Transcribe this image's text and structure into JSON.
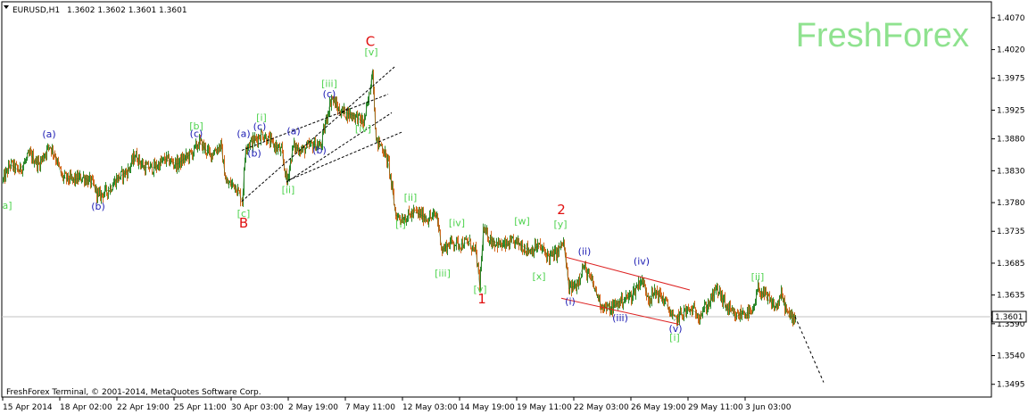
{
  "header": {
    "symbol_timeframe": "EURUSD,H1",
    "ohlc": "1.3602 1.3602 1.3601 1.3601"
  },
  "watermark": "FreshForex",
  "footer": "FreshForex Terminal, © 2001-2014, MetaQuotes Software Corp.",
  "colors": {
    "bull_candle": "#2e8b2e",
    "bear_candle": "#d2691e",
    "green_label": "#4fd34f",
    "blue_label": "#1e1eb4",
    "red_label": "#e01010",
    "watermark": "#8fe28f",
    "channel_red": "#dd2222"
  },
  "chart_data": {
    "type": "candlestick",
    "symbol": "EURUSD",
    "timeframe": "H1",
    "ylim": [
      1.3475,
      1.4095
    ],
    "current_price": 1.3601,
    "y_ticks": [
      "1.4070",
      "1.4020",
      "1.3975",
      "1.3925",
      "1.3880",
      "1.3830",
      "1.3780",
      "1.3735",
      "1.3685",
      "1.3635",
      "1.3590",
      "1.3540",
      "1.3495"
    ],
    "y_tick_values": [
      1.407,
      1.402,
      1.3975,
      1.3925,
      1.388,
      1.383,
      1.378,
      1.3735,
      1.3685,
      1.3635,
      1.359,
      1.354,
      1.3495
    ],
    "x_ticks": [
      "15 Apr 2014",
      "18 Apr 02:00",
      "22 Apr 19:00",
      "25 Apr 11:00",
      "30 Apr 03:00",
      "2 May 19:00",
      "7 May 11:00",
      "12 May 03:00",
      "14 May 19:00",
      "19 May 11:00",
      "22 May 03:00",
      "26 May 19:00",
      "29 May 11:00",
      "3 Jun 03:00"
    ],
    "x_tick_index": [
      0,
      64,
      128,
      192,
      256,
      320,
      384,
      448,
      512,
      576,
      640,
      704,
      768,
      832
    ],
    "price_path": [
      [
        0,
        1.3815
      ],
      [
        8,
        1.384
      ],
      [
        18,
        1.383
      ],
      [
        30,
        1.3855
      ],
      [
        40,
        1.384
      ],
      [
        52,
        1.387
      ],
      [
        58,
        1.3855
      ],
      [
        66,
        1.382
      ],
      [
        78,
        1.3815
      ],
      [
        90,
        1.382
      ],
      [
        100,
        1.381
      ],
      [
        107,
        1.379
      ],
      [
        118,
        1.38
      ],
      [
        128,
        1.3818
      ],
      [
        140,
        1.383
      ],
      [
        148,
        1.3855
      ],
      [
        158,
        1.3835
      ],
      [
        170,
        1.3835
      ],
      [
        182,
        1.3848
      ],
      [
        195,
        1.384
      ],
      [
        212,
        1.3858
      ],
      [
        220,
        1.3875
      ],
      [
        232,
        1.3855
      ],
      [
        244,
        1.387
      ],
      [
        250,
        1.381
      ],
      [
        260,
        1.3808
      ],
      [
        268,
        1.3782
      ],
      [
        272,
        1.387
      ],
      [
        282,
        1.3878
      ],
      [
        290,
        1.3888
      ],
      [
        302,
        1.3872
      ],
      [
        312,
        1.386
      ],
      [
        318,
        1.3812
      ],
      [
        325,
        1.3868
      ],
      [
        336,
        1.3862
      ],
      [
        348,
        1.3872
      ],
      [
        356,
        1.3868
      ],
      [
        362,
        1.391
      ],
      [
        368,
        1.3945
      ],
      [
        376,
        1.3925
      ],
      [
        386,
        1.392
      ],
      [
        396,
        1.3915
      ],
      [
        404,
        1.3905
      ],
      [
        410,
        1.3945
      ],
      [
        414,
        1.399
      ],
      [
        418,
        1.3875
      ],
      [
        424,
        1.387
      ],
      [
        432,
        1.384
      ],
      [
        440,
        1.376
      ],
      [
        448,
        1.3755
      ],
      [
        462,
        1.3765
      ],
      [
        476,
        1.3755
      ],
      [
        486,
        1.376
      ],
      [
        492,
        1.3705
      ],
      [
        502,
        1.3718
      ],
      [
        512,
        1.3715
      ],
      [
        522,
        1.3718
      ],
      [
        530,
        1.37
      ],
      [
        534,
        1.365
      ],
      [
        538,
        1.3735
      ],
      [
        548,
        1.372
      ],
      [
        560,
        1.3712
      ],
      [
        575,
        1.3718
      ],
      [
        590,
        1.3705
      ],
      [
        600,
        1.3712
      ],
      [
        612,
        1.3695
      ],
      [
        620,
        1.37
      ],
      [
        628,
        1.3718
      ],
      [
        634,
        1.3645
      ],
      [
        642,
        1.365
      ],
      [
        650,
        1.368
      ],
      [
        660,
        1.3655
      ],
      [
        670,
        1.362
      ],
      [
        680,
        1.3612
      ],
      [
        692,
        1.3626
      ],
      [
        704,
        1.3634
      ],
      [
        715,
        1.366
      ],
      [
        724,
        1.363
      ],
      [
        732,
        1.364
      ],
      [
        742,
        1.3625
      ],
      [
        752,
        1.3595
      ],
      [
        762,
        1.3608
      ],
      [
        772,
        1.3612
      ],
      [
        780,
        1.3604
      ],
      [
        790,
        1.362
      ],
      [
        800,
        1.3645
      ],
      [
        810,
        1.3618
      ],
      [
        820,
        1.36
      ],
      [
        830,
        1.3608
      ],
      [
        840,
        1.3605
      ],
      [
        846,
        1.3645
      ],
      [
        856,
        1.363
      ],
      [
        866,
        1.3615
      ],
      [
        872,
        1.3635
      ],
      [
        880,
        1.3602
      ],
      [
        888,
        1.3601
      ]
    ],
    "projection": [
      [
        888,
        1.3601
      ],
      [
        920,
        1.3498
      ]
    ],
    "wave_labels": [
      {
        "text": "a]",
        "i": 5,
        "price": 1.377,
        "color": "green"
      },
      {
        "text": "(a)",
        "i": 52,
        "price": 1.3882,
        "color": "blue"
      },
      {
        "text": "(b)",
        "i": 107,
        "price": 1.3769,
        "color": "blue"
      },
      {
        "text": "[b]",
        "i": 217,
        "price": 1.3895,
        "color": "green"
      },
      {
        "text": "(c)",
        "i": 217,
        "price": 1.3883,
        "color": "blue"
      },
      {
        "text": "[c]",
        "i": 270,
        "price": 1.3758,
        "color": "green"
      },
      {
        "text": "B",
        "i": 270,
        "price": 1.3741,
        "color": "red"
      },
      {
        "text": "(a)",
        "i": 270,
        "price": 1.3883,
        "color": "blue"
      },
      {
        "text": "(b)",
        "i": 282,
        "price": 1.3852,
        "color": "blue"
      },
      {
        "text": "[i]",
        "i": 290,
        "price": 1.3908,
        "color": "green"
      },
      {
        "text": "(c)",
        "i": 288,
        "price": 1.3894,
        "color": "blue"
      },
      {
        "text": "(a)",
        "i": 326,
        "price": 1.3887,
        "color": "blue"
      },
      {
        "text": "(b)",
        "i": 355,
        "price": 1.3857,
        "color": "blue"
      },
      {
        "text": "[ii]",
        "i": 320,
        "price": 1.3795,
        "color": "green"
      },
      {
        "text": "[iii]",
        "i": 366,
        "price": 1.3961,
        "color": "green"
      },
      {
        "text": "(c)",
        "i": 366,
        "price": 1.3945,
        "color": "blue"
      },
      {
        "text": "[iv]",
        "i": 404,
        "price": 1.3891,
        "color": "green"
      },
      {
        "text": "C",
        "i": 412,
        "price": 1.4026,
        "color": "red"
      },
      {
        "text": "[v]",
        "i": 413,
        "price": 1.4011,
        "color": "green"
      },
      {
        "text": "[ii]",
        "i": 457,
        "price": 1.3783,
        "color": "green"
      },
      {
        "text": "[i]",
        "i": 446,
        "price": 1.3741,
        "color": "green"
      },
      {
        "text": "[iii]",
        "i": 493,
        "price": 1.3664,
        "color": "green"
      },
      {
        "text": "[iv]",
        "i": 509,
        "price": 1.3743,
        "color": "green"
      },
      {
        "text": "[v]",
        "i": 535,
        "price": 1.3639,
        "color": "green"
      },
      {
        "text": "1",
        "i": 537,
        "price": 1.3622,
        "color": "red"
      },
      {
        "text": "[w]",
        "i": 582,
        "price": 1.3746,
        "color": "green"
      },
      {
        "text": "[x]",
        "i": 601,
        "price": 1.3659,
        "color": "green"
      },
      {
        "text": "2",
        "i": 626,
        "price": 1.3762,
        "color": "red"
      },
      {
        "text": "[y]",
        "i": 625,
        "price": 1.3741,
        "color": "green"
      },
      {
        "text": "(ii)",
        "i": 652,
        "price": 1.3698,
        "color": "blue"
      },
      {
        "text": "(i)",
        "i": 636,
        "price": 1.362,
        "color": "blue"
      },
      {
        "text": "(iii)",
        "i": 692,
        "price": 1.3594,
        "color": "blue"
      },
      {
        "text": "(iv)",
        "i": 716,
        "price": 1.3683,
        "color": "blue"
      },
      {
        "text": "(v)",
        "i": 754,
        "price": 1.3577,
        "color": "blue"
      },
      {
        "text": "[i]",
        "i": 753,
        "price": 1.3563,
        "color": "green"
      },
      {
        "text": "[ii]",
        "i": 846,
        "price": 1.3658,
        "color": "green"
      }
    ],
    "trendlines": [
      {
        "kind": "dashed",
        "color": "black",
        "from": [
          268,
          1.3782
        ],
        "to": [
          440,
          1.3994
        ]
      },
      {
        "kind": "dashed",
        "color": "black",
        "from": [
          268,
          1.3862
        ],
        "to": [
          432,
          1.395
        ]
      },
      {
        "kind": "dashed",
        "color": "black",
        "from": [
          318,
          1.3812
        ],
        "to": [
          436,
          1.3921
        ]
      },
      {
        "kind": "dashed",
        "color": "black",
        "from": [
          320,
          1.3815
        ],
        "to": [
          448,
          1.3891
        ]
      },
      {
        "kind": "solid",
        "color": "red",
        "from": [
          632,
          1.3694
        ],
        "to": [
          770,
          1.3643
        ]
      },
      {
        "kind": "solid",
        "color": "red",
        "from": [
          626,
          1.363
        ],
        "to": [
          758,
          1.3589
        ]
      }
    ]
  }
}
